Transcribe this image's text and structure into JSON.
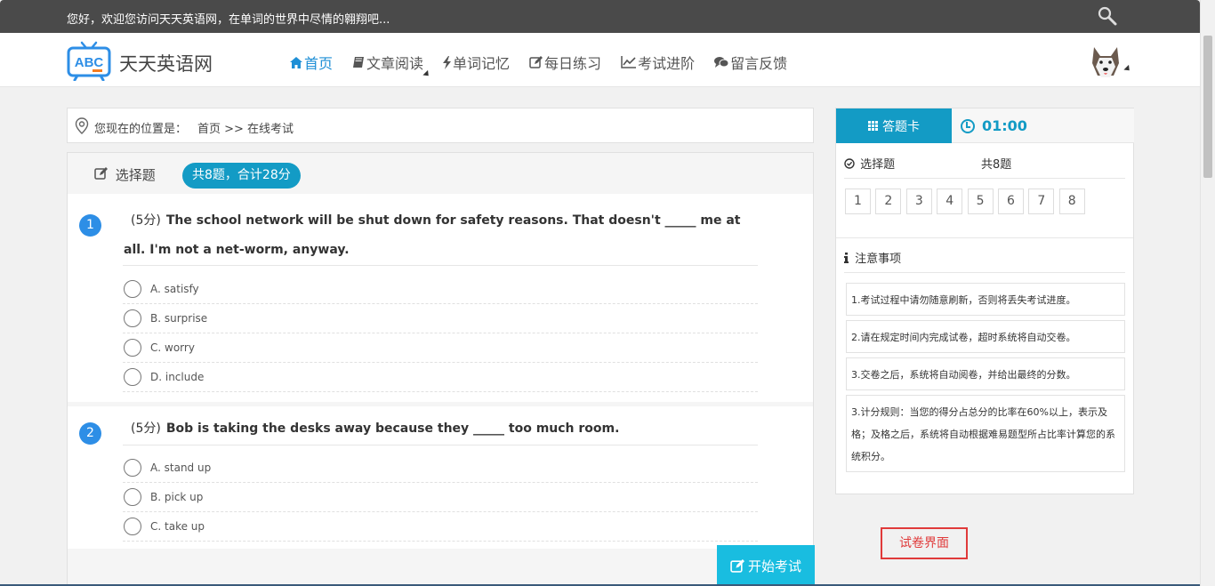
{
  "topbar": {
    "welcome": "您好，欢迎您访问天天英语网，在单词的世界中尽情的翱翔吧..."
  },
  "logo": {
    "badge": "ABC",
    "text": "天天英语网"
  },
  "nav": [
    {
      "label": "首页",
      "icon": "home-icon",
      "active": true
    },
    {
      "label": "文章阅读",
      "icon": "book-icon",
      "dropdown": true
    },
    {
      "label": "单词记忆",
      "icon": "bolt-icon"
    },
    {
      "label": "每日练习",
      "icon": "edit-icon"
    },
    {
      "label": "考试进阶",
      "icon": "chart-icon"
    },
    {
      "label": "留言反馈",
      "icon": "comment-icon"
    }
  ],
  "breadcrumb": {
    "label": "您现在的位置是：",
    "path": "首页 >> 在线考试"
  },
  "exam": {
    "tab": "选择题",
    "summary": "共8题，合计28分",
    "questions": [
      {
        "num": "1",
        "score": "(5分)",
        "text": "The school network will be shut down for safety reasons. That doesn't _____ me at all. I'm not a net-worm, anyway.",
        "options": [
          "A. satisfy",
          "B. surprise",
          "C. worry",
          "D. include"
        ]
      },
      {
        "num": "2",
        "score": "(5分)",
        "text": "Bob is taking the desks away because they _____ too much room.",
        "options": [
          "A. stand up",
          "B. pick up",
          "C. take up"
        ]
      }
    ],
    "start_button": "开始考试"
  },
  "answer_card": {
    "tab_label": "答题卡",
    "timer": "01:00",
    "section": "选择题",
    "count": "共8题",
    "numbers": [
      "1",
      "2",
      "3",
      "4",
      "5",
      "6",
      "7",
      "8"
    ],
    "notes_title": "注意事项",
    "notes": [
      "1.考试过程中请勿随意刷新，否则将丢失考试进度。",
      "2.请在规定时间内完成试卷，超时系统将自动交卷。",
      "3.交卷之后，系统将自动阅卷，并给出最终的分数。",
      "3.计分规则：当您的得分占总分的比率在60%以上，表示及格；及格之后，系统将自动根据难易题型所占比率计算您的系统积分。"
    ]
  },
  "annotation": "试卷界面",
  "colors": {
    "accent": "#139bc5",
    "nav_active": "#1e8fd6",
    "question_badge": "#2d8ee6",
    "start_button": "#19bde0",
    "annotation": "#e03a3a"
  }
}
